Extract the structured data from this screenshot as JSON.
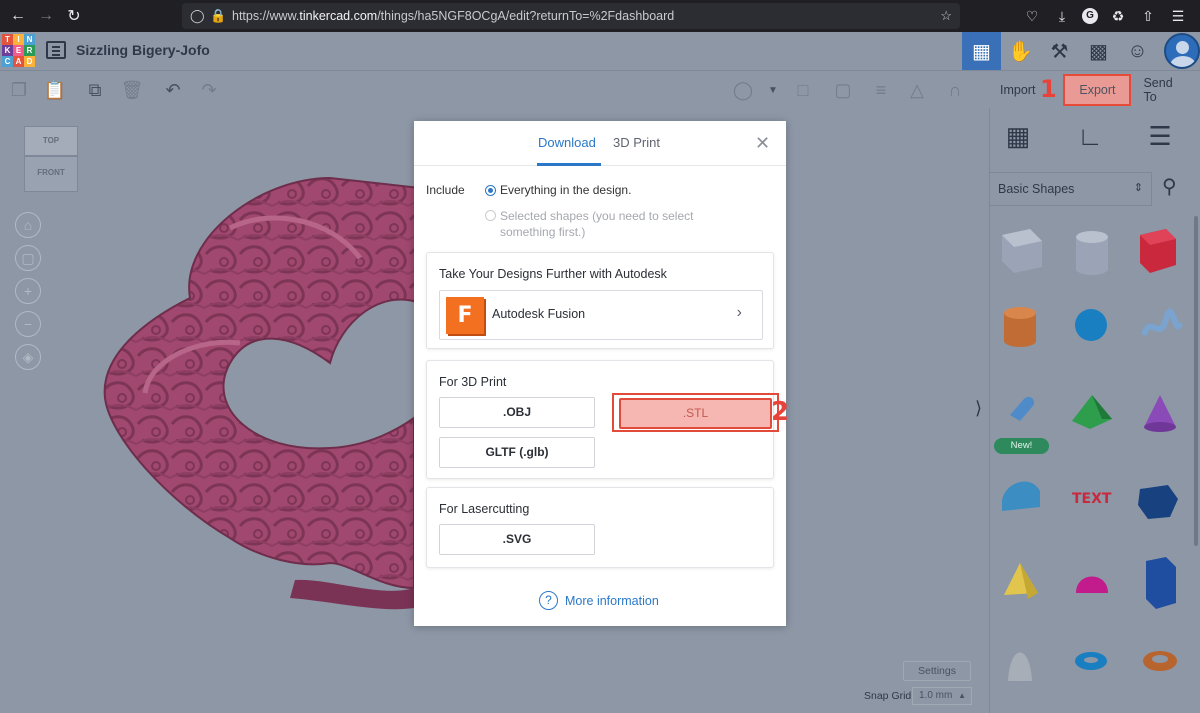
{
  "browser": {
    "url_prefix": "https://www.",
    "url_domain": "tinkercad.com",
    "url_path": "/things/ha5NGF8OCgA/edit?returnTo=%2Fdashboard",
    "profile_initial": "G"
  },
  "header": {
    "logo_letters": [
      "T",
      "I",
      "N",
      "K",
      "E",
      "R",
      "C",
      "A",
      "D"
    ],
    "design_title": "Sizzling Bigery-Jofo"
  },
  "toolbar": {
    "import_label": "Import",
    "export_label": "Export",
    "send_to_label": "Send To"
  },
  "annotations": {
    "step1": "1",
    "step2": "2"
  },
  "workplane": {
    "cube_top": "TOP",
    "cube_front": "FRONT",
    "settings_label": "Settings",
    "snap_grid_label": "Snap Grid",
    "snap_grid_value": "1.0 mm"
  },
  "shapes_panel": {
    "category": "Basic Shapes",
    "new_badge": "New!"
  },
  "modal": {
    "tabs": [
      "Download",
      "3D Print"
    ],
    "active_tab": "Download",
    "include_label": "Include",
    "option_everything": "Everything in the design.",
    "option_selected": "Selected shapes (you need to select something first.)",
    "autodesk_section_title": "Take Your Designs Further with Autodesk",
    "fusion_label": "Autodesk Fusion",
    "fusion_icon_letter": "F",
    "print_section_title": "For 3D Print",
    "print_formats": [
      ".OBJ",
      ".STL",
      "GLTF (.glb)"
    ],
    "laser_section_title": "For Lasercutting",
    "laser_formats": [
      ".SVG"
    ],
    "more_info_label": "More information"
  },
  "colors": {
    "accent": "#2b78c8",
    "highlight_red": "#e24b3c",
    "model_pink": "#a0486f",
    "workplane_bg": "#8d97a6"
  }
}
